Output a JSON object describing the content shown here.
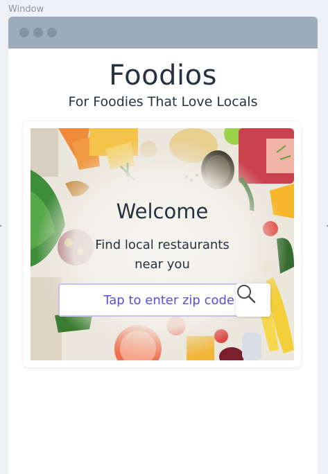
{
  "window": {
    "label": "Window"
  },
  "app": {
    "title": "Foodios",
    "subtitle": "For Foodies That Love Locals"
  },
  "hero": {
    "welcome": "Welcome",
    "tagline": "Find local restaurants near you",
    "search": {
      "placeholder": "Tap to enter zip code",
      "value": "",
      "button_icon": "search-icon"
    }
  },
  "colors": {
    "titlebar": "#9badbb",
    "text": "#26323f",
    "accent": "#5b4fd8",
    "input_border": "#c7c0ee"
  }
}
